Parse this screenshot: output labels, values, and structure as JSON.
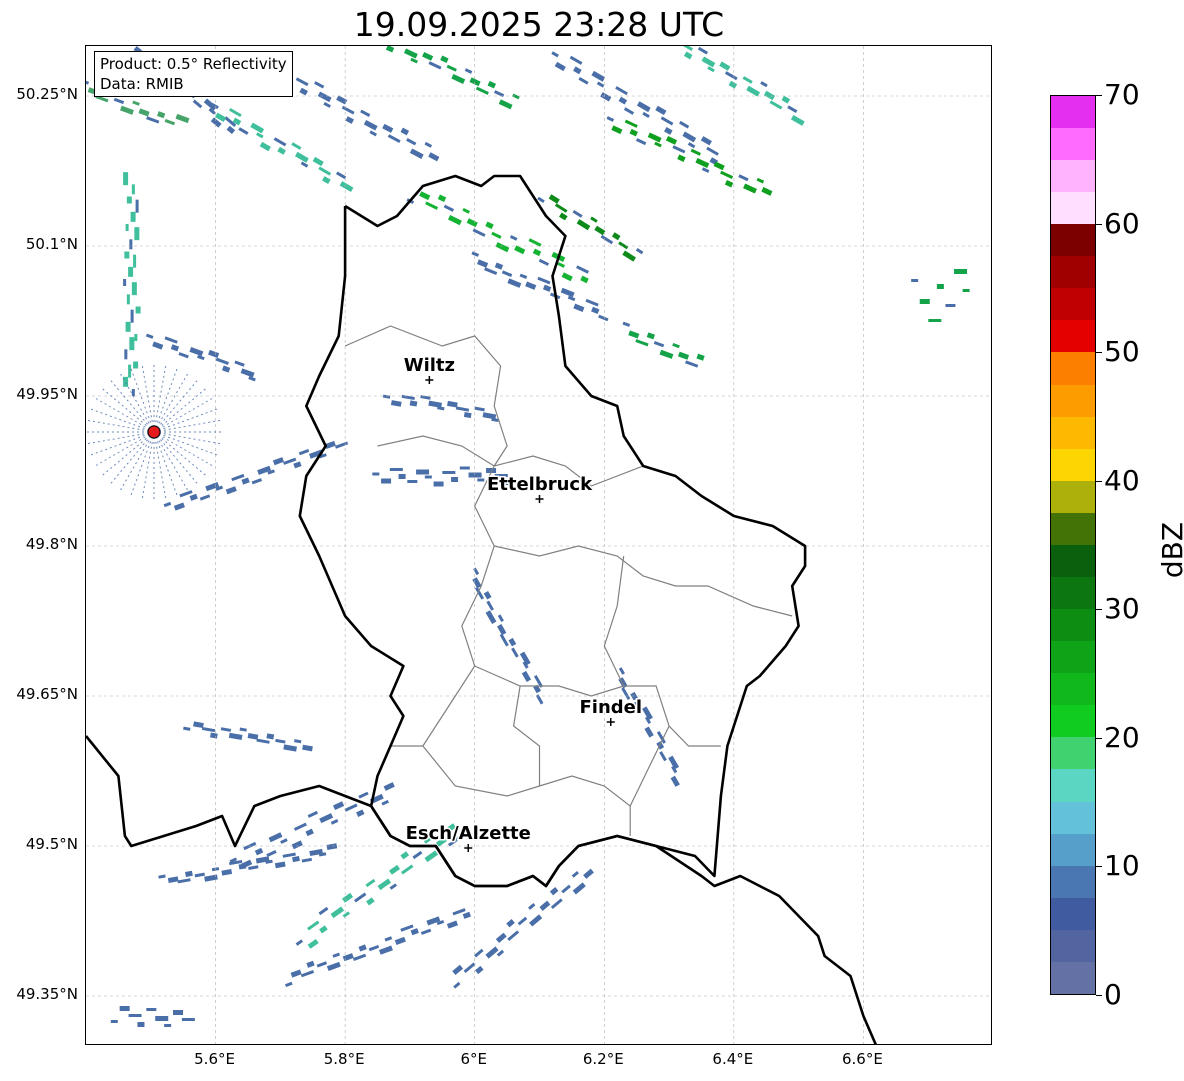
{
  "title": "19.09.2025 23:28 UTC",
  "info_box": {
    "product": "Product: 0.5° Reflectivity",
    "data": "Data: RMIB"
  },
  "map": {
    "extent": {
      "lon_min": 5.4,
      "lon_max": 6.8,
      "lat_min": 49.3,
      "lat_max": 50.3
    },
    "lat_ticks": [
      {
        "value": 50.25,
        "label": "50.25°N"
      },
      {
        "value": 50.1,
        "label": "50.1°N"
      },
      {
        "value": 49.95,
        "label": "49.95°N"
      },
      {
        "value": 49.8,
        "label": "49.8°N"
      },
      {
        "value": 49.65,
        "label": "49.65°N"
      },
      {
        "value": 49.5,
        "label": "49.5°N"
      },
      {
        "value": 49.35,
        "label": "49.35°N"
      }
    ],
    "lon_ticks": [
      {
        "value": 5.6,
        "label": "5.6°E"
      },
      {
        "value": 5.8,
        "label": "5.8°E"
      },
      {
        "value": 6.0,
        "label": "6°E"
      },
      {
        "value": 6.2,
        "label": "6.2°E"
      },
      {
        "value": 6.4,
        "label": "6.4°E"
      },
      {
        "value": 6.6,
        "label": "6.6°E"
      }
    ],
    "cities": [
      {
        "name": "Wiltz",
        "lon": 5.93,
        "lat": 49.966
      },
      {
        "name": "Ettelbruck",
        "lon": 6.1,
        "lat": 49.847
      },
      {
        "name": "Findel",
        "lon": 6.21,
        "lat": 49.624
      },
      {
        "name": "Esch/Alzette",
        "lon": 5.99,
        "lat": 49.498
      }
    ],
    "radar_site": {
      "lon": 5.505,
      "lat": 49.914,
      "color": "#e41a1c"
    },
    "border": [
      [
        5.4,
        49.61
      ],
      [
        5.45,
        49.57
      ],
      [
        5.46,
        49.51
      ],
      [
        5.47,
        49.5
      ],
      [
        5.52,
        49.51
      ],
      [
        5.57,
        49.52
      ],
      [
        5.61,
        49.53
      ],
      [
        5.63,
        49.5
      ],
      [
        5.66,
        49.54
      ],
      [
        5.7,
        49.55
      ],
      [
        5.76,
        49.56
      ],
      [
        5.8,
        49.55
      ],
      [
        5.84,
        49.54
      ],
      [
        5.87,
        49.51
      ],
      [
        5.9,
        49.5
      ],
      [
        5.94,
        49.5
      ],
      [
        5.97,
        49.47
      ],
      [
        6.0,
        49.46
      ],
      [
        6.05,
        49.46
      ],
      [
        6.09,
        49.47
      ],
      [
        6.11,
        49.46
      ],
      [
        6.13,
        49.48
      ],
      [
        6.16,
        49.5
      ],
      [
        6.22,
        49.51
      ],
      [
        6.28,
        49.5
      ],
      [
        6.35,
        49.47
      ],
      [
        6.37,
        49.46
      ],
      [
        6.41,
        49.47
      ],
      [
        6.47,
        49.45
      ],
      [
        6.53,
        49.41
      ],
      [
        6.54,
        49.39
      ],
      [
        6.58,
        49.37
      ],
      [
        6.6,
        49.33
      ],
      [
        6.62,
        49.3
      ]
    ],
    "lux_border": [
      [
        5.8,
        50.14
      ],
      [
        5.85,
        50.12
      ],
      [
        5.88,
        50.13
      ],
      [
        5.92,
        50.16
      ],
      [
        5.97,
        50.17
      ],
      [
        6.01,
        50.16
      ],
      [
        6.03,
        50.17
      ],
      [
        6.07,
        50.17
      ],
      [
        6.11,
        50.13
      ],
      [
        6.14,
        50.11
      ],
      [
        6.12,
        50.07
      ],
      [
        6.13,
        50.03
      ],
      [
        6.14,
        49.98
      ],
      [
        6.18,
        49.95
      ],
      [
        6.22,
        49.94
      ],
      [
        6.23,
        49.91
      ],
      [
        6.26,
        49.88
      ],
      [
        6.31,
        49.87
      ],
      [
        6.35,
        49.85
      ],
      [
        6.4,
        49.83
      ],
      [
        6.46,
        49.82
      ],
      [
        6.51,
        49.8
      ],
      [
        6.51,
        49.78
      ],
      [
        6.49,
        49.76
      ],
      [
        6.5,
        49.72
      ],
      [
        6.48,
        49.7
      ],
      [
        6.44,
        49.67
      ],
      [
        6.42,
        49.66
      ],
      [
        6.39,
        49.6
      ],
      [
        6.38,
        49.55
      ],
      [
        6.37,
        49.47
      ],
      [
        6.34,
        49.49
      ],
      [
        6.28,
        49.5
      ],
      [
        6.22,
        49.51
      ],
      [
        6.16,
        49.5
      ],
      [
        6.13,
        49.48
      ],
      [
        6.11,
        49.46
      ],
      [
        6.09,
        49.47
      ],
      [
        6.05,
        49.46
      ],
      [
        6.0,
        49.46
      ],
      [
        5.97,
        49.47
      ],
      [
        5.94,
        49.5
      ],
      [
        5.9,
        49.5
      ],
      [
        5.87,
        49.51
      ],
      [
        5.84,
        49.54
      ],
      [
        5.85,
        49.57
      ],
      [
        5.87,
        49.6
      ],
      [
        5.89,
        49.63
      ],
      [
        5.87,
        49.65
      ],
      [
        5.89,
        49.68
      ],
      [
        5.84,
        49.7
      ],
      [
        5.8,
        49.73
      ],
      [
        5.76,
        49.79
      ],
      [
        5.73,
        49.83
      ],
      [
        5.74,
        49.87
      ],
      [
        5.77,
        49.9
      ],
      [
        5.74,
        49.94
      ],
      [
        5.76,
        49.97
      ],
      [
        5.79,
        50.01
      ],
      [
        5.8,
        50.07
      ],
      [
        5.8,
        50.14
      ]
    ],
    "cantons": [
      [
        [
          5.8,
          50.0
        ],
        [
          5.87,
          50.02
        ],
        [
          5.95,
          50.0
        ],
        [
          6.0,
          50.01
        ],
        [
          6.04,
          49.98
        ],
        [
          6.03,
          49.94
        ],
        [
          6.05,
          49.9
        ],
        [
          6.03,
          49.88
        ]
      ],
      [
        [
          5.85,
          49.9
        ],
        [
          5.92,
          49.91
        ],
        [
          5.98,
          49.9
        ],
        [
          6.03,
          49.88
        ],
        [
          6.09,
          49.89
        ],
        [
          6.14,
          49.88
        ],
        [
          6.18,
          49.86
        ],
        [
          6.26,
          49.88
        ]
      ],
      [
        [
          6.03,
          49.88
        ],
        [
          6.0,
          49.84
        ],
        [
          6.03,
          49.8
        ],
        [
          6.01,
          49.76
        ],
        [
          5.98,
          49.72
        ],
        [
          6.0,
          49.68
        ],
        [
          5.96,
          49.64
        ],
        [
          5.92,
          49.6
        ],
        [
          5.87,
          49.6
        ]
      ],
      [
        [
          6.03,
          49.8
        ],
        [
          6.1,
          49.79
        ],
        [
          6.16,
          49.8
        ],
        [
          6.22,
          49.79
        ],
        [
          6.26,
          49.77
        ],
        [
          6.31,
          49.76
        ],
        [
          6.36,
          49.76
        ],
        [
          6.43,
          49.74
        ],
        [
          6.49,
          49.73
        ]
      ],
      [
        [
          6.0,
          49.68
        ],
        [
          6.07,
          49.66
        ],
        [
          6.13,
          49.66
        ],
        [
          6.18,
          49.65
        ],
        [
          6.23,
          49.66
        ],
        [
          6.28,
          49.66
        ],
        [
          6.3,
          49.62
        ],
        [
          6.33,
          49.6
        ],
        [
          6.38,
          49.6
        ]
      ],
      [
        [
          6.23,
          49.79
        ],
        [
          6.22,
          49.74
        ],
        [
          6.2,
          49.7
        ],
        [
          6.23,
          49.66
        ]
      ],
      [
        [
          5.92,
          49.6
        ],
        [
          5.97,
          49.56
        ],
        [
          6.05,
          49.55
        ],
        [
          6.1,
          49.56
        ],
        [
          6.15,
          49.57
        ],
        [
          6.2,
          49.56
        ],
        [
          6.24,
          49.54
        ],
        [
          6.24,
          49.51
        ]
      ],
      [
        [
          6.07,
          49.66
        ],
        [
          6.06,
          49.62
        ],
        [
          6.1,
          49.6
        ],
        [
          6.1,
          49.56
        ]
      ],
      [
        [
          6.3,
          49.62
        ],
        [
          6.27,
          49.58
        ],
        [
          6.24,
          49.54
        ]
      ]
    ],
    "radar_bands": [
      {
        "lon": 5.47,
        "lat": 50.24,
        "angle": 20,
        "len": 110,
        "w": 10,
        "color": "#46a46a"
      },
      {
        "lon": 5.55,
        "lat": 50.26,
        "angle": 40,
        "len": 140,
        "w": 10,
        "color": "#4a6fa8"
      },
      {
        "lon": 5.7,
        "lat": 50.2,
        "angle": 30,
        "len": 160,
        "w": 12,
        "color": "#3fbf9b"
      },
      {
        "lon": 5.82,
        "lat": 50.23,
        "angle": 28,
        "len": 180,
        "w": 14,
        "color": "#4a6fa8"
      },
      {
        "lon": 5.95,
        "lat": 50.28,
        "angle": 25,
        "len": 170,
        "w": 12,
        "color": "#15a34a"
      },
      {
        "lon": 6.04,
        "lat": 50.11,
        "angle": 26,
        "len": 200,
        "w": 14,
        "color": "#15b333"
      },
      {
        "lon": 6.1,
        "lat": 50.06,
        "angle": 22,
        "len": 150,
        "w": 10,
        "color": "#4a6fa8"
      },
      {
        "lon": 6.25,
        "lat": 50.24,
        "angle": 30,
        "len": 200,
        "w": 14,
        "color": "#4a6fa8"
      },
      {
        "lon": 6.33,
        "lat": 50.19,
        "angle": 25,
        "len": 180,
        "w": 12,
        "color": "#10a020"
      },
      {
        "lon": 6.4,
        "lat": 50.27,
        "angle": 30,
        "len": 160,
        "w": 12,
        "color": "#3fbf9b"
      },
      {
        "lon": 6.18,
        "lat": 50.12,
        "angle": 32,
        "len": 120,
        "w": 10,
        "color": "#0e8a1a"
      },
      {
        "lon": 6.29,
        "lat": 50.0,
        "angle": 20,
        "len": 90,
        "w": 12,
        "color": "#15a34a"
      },
      {
        "lon": 6.72,
        "lat": 50.05,
        "angle": 0,
        "len": 60,
        "w": 40,
        "color": "#15a34a"
      },
      {
        "lon": 5.75,
        "lat": 49.52,
        "angle": -25,
        "len": 180,
        "w": 16,
        "color": "#4a6fa8"
      },
      {
        "lon": 5.85,
        "lat": 49.46,
        "angle": -35,
        "len": 200,
        "w": 16,
        "color": "#3fbf9b"
      },
      {
        "lon": 6.07,
        "lat": 49.42,
        "angle": -40,
        "len": 180,
        "w": 14,
        "color": "#4a6fa8"
      },
      {
        "lon": 5.85,
        "lat": 49.4,
        "angle": -20,
        "len": 200,
        "w": 10,
        "color": "#4a6fa8"
      },
      {
        "lon": 5.65,
        "lat": 49.48,
        "angle": -10,
        "len": 180,
        "w": 8,
        "color": "#4a6fa8"
      },
      {
        "lon": 5.66,
        "lat": 49.87,
        "angle": -20,
        "len": 190,
        "w": 10,
        "color": "#4a6fa8"
      },
      {
        "lon": 5.58,
        "lat": 49.99,
        "angle": 20,
        "len": 120,
        "w": 10,
        "color": "#4a6fa8"
      },
      {
        "lon": 5.47,
        "lat": 50.06,
        "angle": -90,
        "len": 220,
        "w": 10,
        "color": "#3fbf9b"
      },
      {
        "lon": 5.65,
        "lat": 49.61,
        "angle": 10,
        "len": 130,
        "w": 8,
        "color": "#4a6fa8"
      },
      {
        "lon": 6.05,
        "lat": 49.71,
        "angle": 60,
        "len": 150,
        "w": 8,
        "color": "#4a6fa8"
      },
      {
        "lon": 6.27,
        "lat": 49.62,
        "angle": 60,
        "len": 130,
        "w": 8,
        "color": "#4a6fa8"
      },
      {
        "lon": 5.95,
        "lat": 49.87,
        "angle": 0,
        "len": 140,
        "w": 12,
        "color": "#4a6fa8"
      },
      {
        "lon": 5.95,
        "lat": 49.94,
        "angle": 10,
        "len": 120,
        "w": 8,
        "color": "#4a6fa8"
      },
      {
        "lon": 5.5,
        "lat": 49.33,
        "angle": 0,
        "len": 80,
        "w": 16,
        "color": "#4a6fa8"
      }
    ]
  },
  "colorbar": {
    "unit": "dBZ",
    "min": 0,
    "max": 70,
    "ticks": [
      {
        "value": 0,
        "label": "0"
      },
      {
        "value": 10,
        "label": "10"
      },
      {
        "value": 20,
        "label": "20"
      },
      {
        "value": 30,
        "label": "30"
      },
      {
        "value": 40,
        "label": "40"
      },
      {
        "value": 50,
        "label": "50"
      },
      {
        "value": 60,
        "label": "60"
      },
      {
        "value": 70,
        "label": "70"
      }
    ],
    "colors": [
      "#6371a5",
      "#5265a0",
      "#415ba0",
      "#4a77b1",
      "#579fcb",
      "#63c2d9",
      "#5bd6c2",
      "#3fd26f",
      "#10cb20",
      "#10b81c",
      "#0fa417",
      "#0e8d13",
      "#0c7710",
      "#0a600d",
      "#437307",
      "#adb00b",
      "#fdd500",
      "#fdb802",
      "#fd9c00",
      "#fd7f00",
      "#e50000",
      "#c00000",
      "#a00000",
      "#7d0000",
      "#ffdfff",
      "#ffb3ff",
      "#ff6aff",
      "#e52ff0"
    ]
  }
}
